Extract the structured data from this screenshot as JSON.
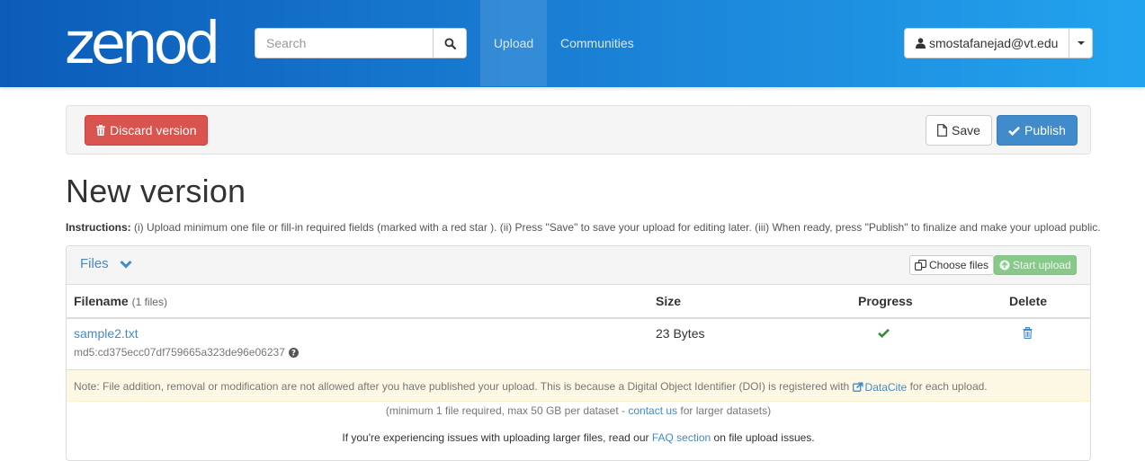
{
  "header": {
    "logo_text": "zenodo",
    "search": {
      "placeholder": "Search",
      "value": ""
    },
    "nav": [
      {
        "label": "Upload",
        "active": true
      },
      {
        "label": "Communities",
        "active": false
      }
    ],
    "user": {
      "email": "smostafanejad@vt.edu"
    }
  },
  "actions": {
    "discard_label": "Discard version",
    "save_label": "Save",
    "publish_label": "Publish"
  },
  "page": {
    "title": "New version",
    "instructions_label": "Instructions:",
    "instructions_text": " (i) Upload minimum one file or fill-in required fields (marked with a red star ). (ii) Press \"Save\" to save your upload for editing later. (iii) When ready, press \"Publish\" to finalize and make your upload public."
  },
  "files": {
    "heading": "Files",
    "choose_label": "Choose files",
    "start_label": "Start upload",
    "columns": {
      "filename": "Filename",
      "filename_count": "(1 files)",
      "size": "Size",
      "progress": "Progress",
      "delete": "Delete"
    },
    "rows": [
      {
        "name": "sample2.txt",
        "checksum": "md5:cd375ecc07df759665a323de96e06237",
        "size": "23 Bytes",
        "progress": "complete"
      }
    ],
    "note": {
      "text_before": "Note: File addition, removal or modification are not allowed after you have published your upload. This is because a Digital Object Identifier (DOI) is registered with ",
      "link": "DataCite",
      "text_after": " for each upload."
    },
    "limits": {
      "before": "(minimum 1 file required, max 50 GB per dataset - ",
      "link": "contact us",
      "after": " for larger datasets)"
    },
    "faq": {
      "before": "If you're experiencing issues with uploading larger files, read our ",
      "link": "FAQ section",
      "after": " on file upload issues."
    }
  },
  "colors": {
    "header_start": "#0b5cb8",
    "header_end": "#22a3ee",
    "danger": "#d9534f",
    "primary": "#428bca",
    "success": "#5cb85c",
    "link": "#428bca",
    "warning_bg": "#fcf8e3"
  }
}
